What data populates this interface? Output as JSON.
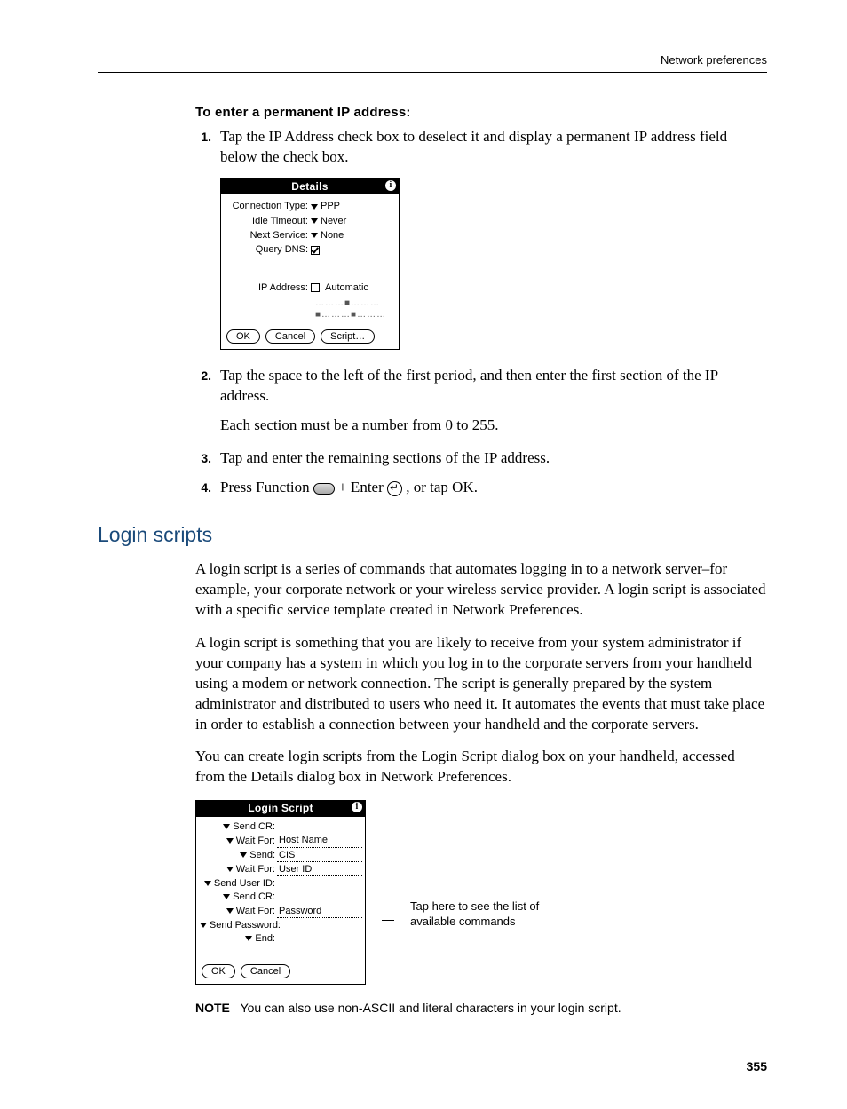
{
  "running_head": "Network preferences",
  "page_number": "355",
  "section1": {
    "title": "To enter a permanent IP address:",
    "steps": {
      "s1_num": "1.",
      "s1": "Tap the IP Address check box to deselect it and display a permanent IP address field below the check box.",
      "s2_num": "2.",
      "s2": "Tap the space to the left of the first period, and then enter the first section of the IP address.",
      "s2_sub": "Each section must be a number from 0 to 255.",
      "s3_num": "3.",
      "s3": "Tap and enter the remaining sections of the IP address.",
      "s4_num": "4.",
      "s4_pre": "Press Function ",
      "s4_mid": " + Enter ",
      "s4_post": " , or tap OK."
    }
  },
  "details_dialog": {
    "title": "Details",
    "rows": {
      "conn_label": "Connection Type:",
      "conn_value": "PPP",
      "idle_label": "Idle Timeout:",
      "idle_value": "Never",
      "next_label": "Next Service:",
      "next_value": "None",
      "dns_label": "Query DNS:",
      "ip_label": "IP Address:",
      "ip_value": "Automatic"
    },
    "ip_dots": "………■………■………■………",
    "buttons": {
      "ok": "OK",
      "cancel": "Cancel",
      "script": "Script…"
    }
  },
  "h2": "Login scripts",
  "para1": "A login script is a series of commands that automates logging in to a network server–for example, your corporate network or your wireless service provider. A login script is associated with a specific service template created in Network Preferences.",
  "para2": "A login script is something that you are likely to receive from your system administrator if your company has a system in which you log in to the corporate servers from your handheld using a modem or network connection. The script is generally prepared by the system administrator and distributed to users who need it. It automates the events that must take place in order to establish a connection between your handheld and the corporate servers.",
  "para3": "You can create login scripts from the Login Script dialog box on your handheld, accessed from the Details dialog box in Network Preferences.",
  "login_dialog": {
    "title": "Login Script",
    "rows": [
      {
        "label": "Send CR:",
        "value": ""
      },
      {
        "label": "Wait For:",
        "value": "Host Name"
      },
      {
        "label": "Send:",
        "value": "CIS"
      },
      {
        "label": "Wait For:",
        "value": "User ID"
      },
      {
        "label": "Send User ID:",
        "value": ""
      },
      {
        "label": "Send CR:",
        "value": ""
      },
      {
        "label": "Wait For:",
        "value": "Password"
      },
      {
        "label": "Send Password:",
        "value": ""
      },
      {
        "label": "End:",
        "value": ""
      }
    ],
    "buttons": {
      "ok": "OK",
      "cancel": "Cancel"
    }
  },
  "callout1": "Tap here to see the list of",
  "callout2": "available commands",
  "note_label": "NOTE",
  "note_text": "You can also use non-ASCII and literal characters in your login script."
}
